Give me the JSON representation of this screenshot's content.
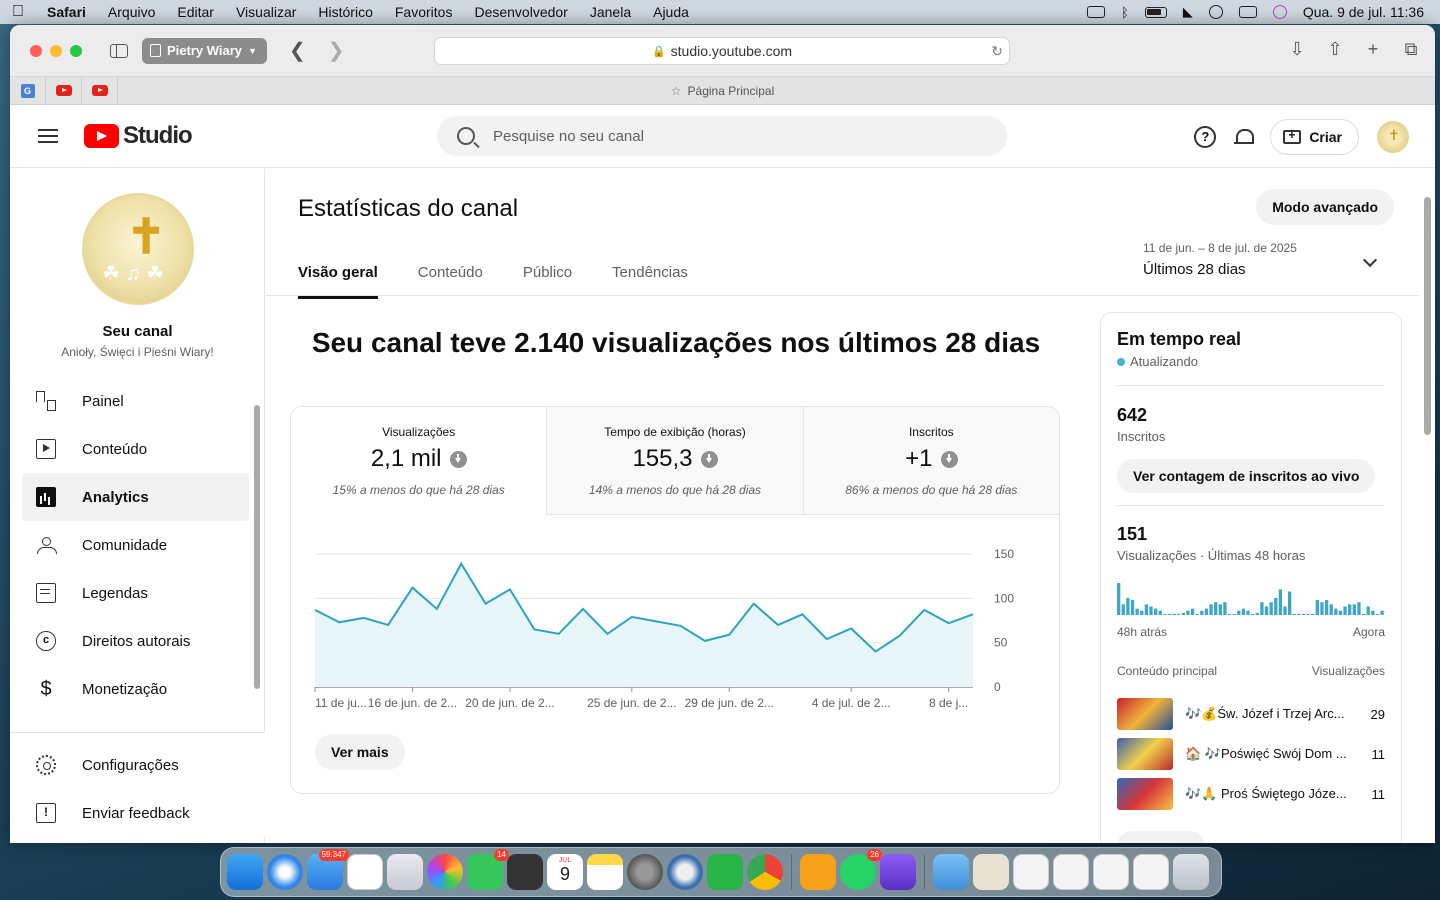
{
  "menubar": {
    "app": "Safari",
    "items": [
      "Arquivo",
      "Editar",
      "Visualizar",
      "Histórico",
      "Favoritos",
      "Desenvolvedor",
      "Janela",
      "Ajuda"
    ],
    "datetime": "Qua. 9 de jul.  11:36"
  },
  "browser": {
    "profile": "Pietry Wiary",
    "url": "studio.youtube.com",
    "tab_title": "Página Principal"
  },
  "header": {
    "logo_text": "Studio",
    "search_placeholder": "Pesquise no seu canal",
    "create_label": "Criar"
  },
  "sidebar": {
    "channel_title": "Seu canal",
    "channel_name": "Anioły, Święci i Pieśni Wiary!",
    "items": [
      {
        "label": "Painel",
        "icon": "dashboard-icon"
      },
      {
        "label": "Conteúdo",
        "icon": "content-icon"
      },
      {
        "label": "Analytics",
        "icon": "analytics-icon",
        "active": true
      },
      {
        "label": "Comunidade",
        "icon": "community-icon"
      },
      {
        "label": "Legendas",
        "icon": "subtitles-icon"
      },
      {
        "label": "Direitos autorais",
        "icon": "copyright-icon"
      },
      {
        "label": "Monetização",
        "icon": "monetization-icon"
      }
    ],
    "bottom_items": [
      {
        "label": "Configurações",
        "icon": "settings-icon"
      },
      {
        "label": "Enviar feedback",
        "icon": "feedback-icon"
      }
    ]
  },
  "main": {
    "title": "Estatísticas do canal",
    "advanced_label": "Modo avançado",
    "tabs": [
      "Visão geral",
      "Conteúdo",
      "Público",
      "Tendências"
    ],
    "date_range": {
      "dates": "11 de jun. – 8 de jul. de 2025",
      "label": "Últimos 28 dias"
    },
    "headline": "Seu canal teve 2.140 visualizações nos últimos 28 dias",
    "metrics": [
      {
        "label": "Visualizações",
        "value": "2,1 mil",
        "delta": "15% a menos do que há 28 dias"
      },
      {
        "label": "Tempo de exibição (horas)",
        "value": "155,3",
        "delta": "14% a menos do que há 28 dias"
      },
      {
        "label": "Inscritos",
        "value": "+1",
        "delta": "86% a menos do que há 28 dias"
      }
    ],
    "see_more_label": "Ver mais"
  },
  "chart_data": {
    "type": "area",
    "x": [
      "11 de ju...",
      "",
      "",
      "",
      "16 de jun. de 2...",
      "",
      "",
      "",
      "20 de jun. de 2...",
      "",
      "",
      "",
      "",
      "25 de jun. de 2...",
      "",
      "",
      "",
      "29 de jun. de 2...",
      "",
      "",
      "",
      "",
      "4 de jul. de 2...",
      "",
      "",
      "",
      "8 de j..."
    ],
    "x_tick_labels": [
      "11 de ju...",
      "16 de jun. de 2...",
      "20 de jun. de 2...",
      "25 de jun. de 2...",
      "29 de jun. de 2...",
      "4 de jul. de 2...",
      "8 de j..."
    ],
    "series": [
      {
        "values": [
          87,
          73,
          78,
          70,
          112,
          88,
          139,
          94,
          110,
          65,
          60,
          88,
          60,
          79,
          74,
          69,
          52,
          59,
          94,
          70,
          82,
          54,
          66,
          40,
          58,
          87,
          72,
          82
        ]
      }
    ],
    "y_ticks": [
      0,
      50,
      100,
      150
    ],
    "ylim": [
      0,
      150
    ],
    "colors": {
      "line": "#2ba3c4",
      "fill": "#e8f5f9"
    },
    "grid": true
  },
  "realtime": {
    "title": "Em tempo real",
    "status": "Atualizando",
    "subscribers_value": "642",
    "subscribers_label": "Inscritos",
    "live_count_label": "Ver contagem de inscritos ao vivo",
    "views_value": "151",
    "views_label": "Visualizações · Últimas 48 horas",
    "bars": [
      30,
      10,
      16,
      14,
      6,
      4,
      10,
      8,
      6,
      4,
      0,
      0,
      0,
      0,
      2,
      4,
      6,
      0,
      4,
      6,
      10,
      12,
      10,
      12,
      0,
      0,
      4,
      6,
      4,
      0,
      2,
      12,
      8,
      12,
      16,
      24,
      8,
      22,
      0,
      0,
      0,
      0,
      0,
      14,
      12,
      14,
      10,
      6,
      4,
      8,
      10,
      10,
      12,
      0,
      8,
      4,
      0,
      4
    ],
    "axis_left": "48h atrás",
    "axis_right": "Agora",
    "table_header_left": "Conteúdo principal",
    "table_header_right": "Visualizações",
    "top_content": [
      {
        "title": "🎶💰Św. Józef i Trzej Arc...",
        "views": "29"
      },
      {
        "title": "🏠 🎶Poświęć Swój Dom ...",
        "views": "11"
      },
      {
        "title": "🎶🙏 Proś Świętego Józe...",
        "views": "11"
      }
    ]
  },
  "dock": {
    "badges": {
      "mail": "59.347",
      "facetime": "14",
      "whatsapp": "26"
    },
    "calendar": {
      "month": "JUL",
      "day": "9"
    }
  }
}
